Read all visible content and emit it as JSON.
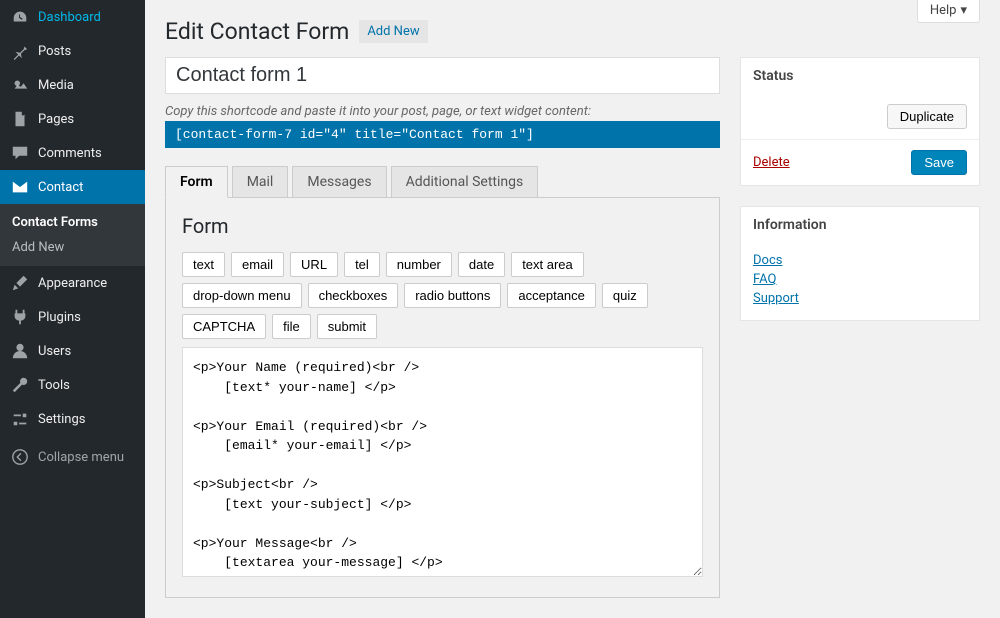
{
  "help": "Help",
  "sidebar": {
    "items": [
      {
        "label": "Dashboard"
      },
      {
        "label": "Posts"
      },
      {
        "label": "Media"
      },
      {
        "label": "Pages"
      },
      {
        "label": "Comments"
      },
      {
        "label": "Contact"
      },
      {
        "label": "Appearance"
      },
      {
        "label": "Plugins"
      },
      {
        "label": "Users"
      },
      {
        "label": "Tools"
      },
      {
        "label": "Settings"
      }
    ],
    "submenu": {
      "items": [
        {
          "label": "Contact Forms"
        },
        {
          "label": "Add New"
        }
      ]
    },
    "collapse": "Collapse menu"
  },
  "header": {
    "title": "Edit Contact Form",
    "add_new": "Add New"
  },
  "form": {
    "title_value": "Contact form 1",
    "shortcode_hint": "Copy this shortcode and paste it into your post, page, or text widget content:",
    "shortcode": "[contact-form-7 id=\"4\" title=\"Contact form 1\"]"
  },
  "tabs": [
    "Form",
    "Mail",
    "Messages",
    "Additional Settings"
  ],
  "panel": {
    "heading": "Form",
    "tags": [
      "text",
      "email",
      "URL",
      "tel",
      "number",
      "date",
      "text area",
      "drop-down menu",
      "checkboxes",
      "radio buttons",
      "acceptance",
      "quiz",
      "CAPTCHA",
      "file",
      "submit"
    ],
    "textarea": "<p>Your Name (required)<br />\n    [text* your-name] </p>\n\n<p>Your Email (required)<br />\n    [email* your-email] </p>\n\n<p>Subject<br />\n    [text your-subject] </p>\n\n<p>Your Message<br />\n    [textarea your-message] </p>\n\n<p>[submit \"Send\"]</p>"
  },
  "status": {
    "title": "Status",
    "duplicate": "Duplicate",
    "delete": "Delete",
    "save": "Save"
  },
  "info": {
    "title": "Information",
    "links": [
      "Docs",
      "FAQ",
      "Support"
    ]
  }
}
